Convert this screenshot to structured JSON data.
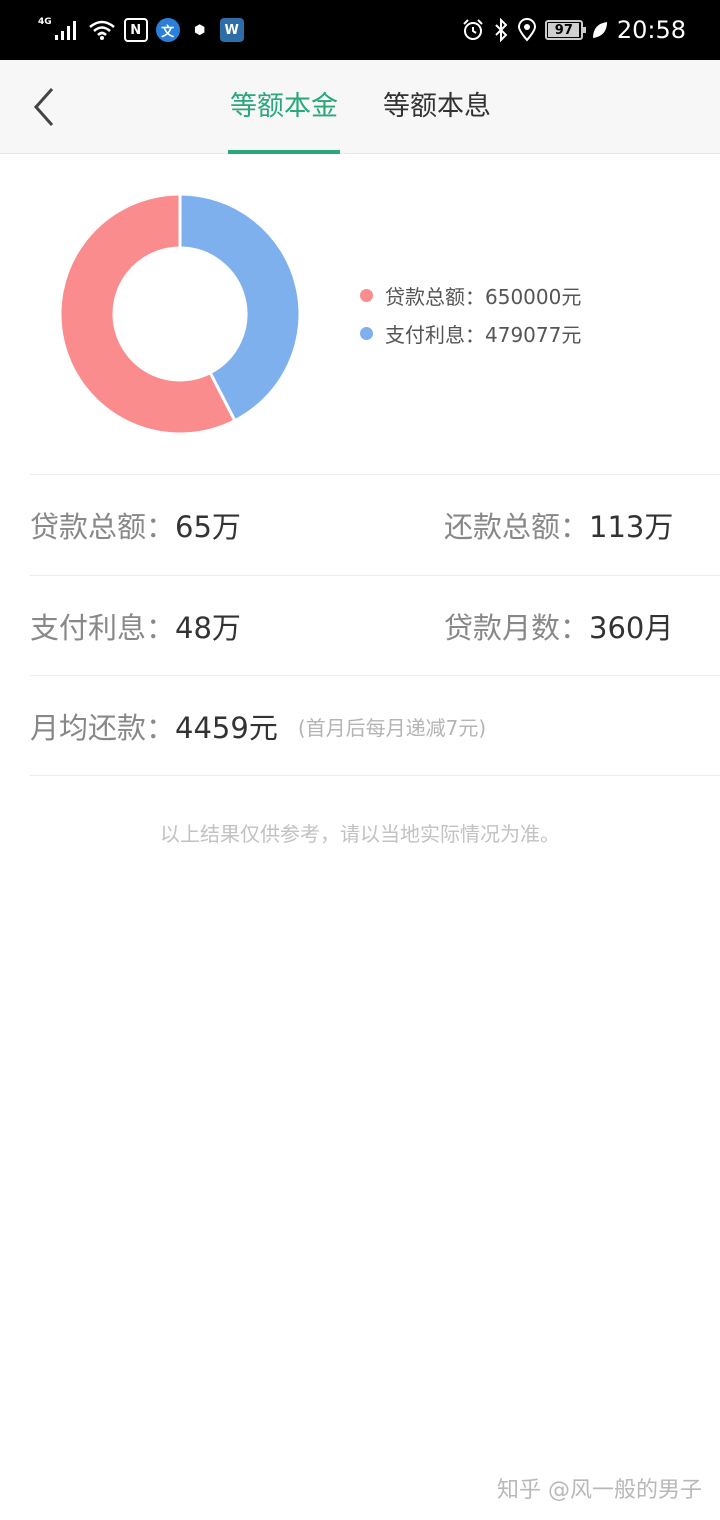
{
  "status_bar": {
    "network": "4G",
    "battery": "97",
    "time": "20:58"
  },
  "nav": {
    "tabs": [
      {
        "label": "等额本金",
        "active": true
      },
      {
        "label": "等额本息",
        "active": false
      }
    ]
  },
  "chart_data": {
    "type": "pie",
    "slices": [
      {
        "name": "贷款总额",
        "value": 650000,
        "color": "#fb8c8e"
      },
      {
        "name": "支付利息",
        "value": 479077,
        "color": "#7fb0ee"
      }
    ]
  },
  "legend": [
    {
      "label": "贷款总额：650000元",
      "color": "#fb8c8e"
    },
    {
      "label": "支付利息：479077元",
      "color": "#7fb0ee"
    }
  ],
  "stats": {
    "loan_total": {
      "label": "贷款总额：",
      "value": "65万"
    },
    "repay_total": {
      "label": "还款总额：",
      "value": "113万"
    },
    "interest": {
      "label": "支付利息：",
      "value": "48万"
    },
    "months": {
      "label": "贷款月数：",
      "value": "360月"
    },
    "monthly": {
      "label": "月均还款：",
      "value": "4459元",
      "note": "(首月后每月递减7元)"
    }
  },
  "disclaimer": "以上结果仅供参考，请以当地实际情况为准。",
  "watermark": "知乎 @风一般的男子"
}
